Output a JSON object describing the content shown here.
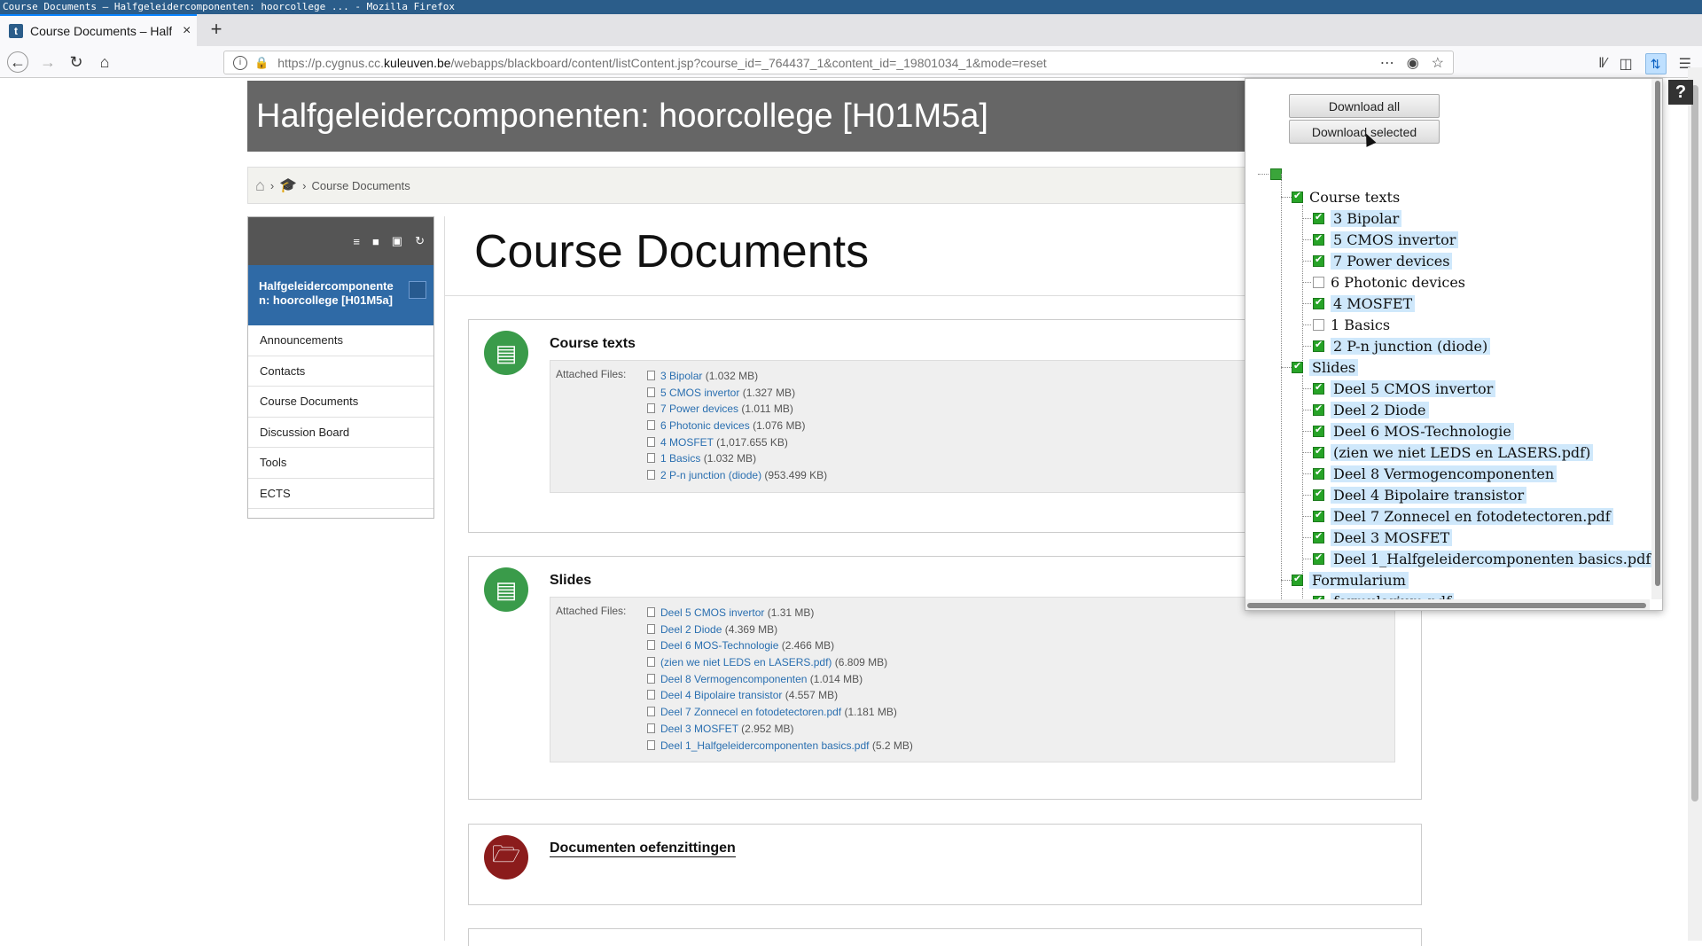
{
  "window": {
    "title": "Course Documents – Halfgeleidercomponenten: hoorcollege ... - Mozilla Firefox"
  },
  "tab": {
    "favicon": "t",
    "title": "Course Documents – Halfgeleidercomponenten",
    "close": "×",
    "new": "+"
  },
  "nav": {
    "url_prefix": "https://p.cygnus.cc.",
    "url_domain": "kuleuven.be",
    "url_path": "/webapps/blackboard/content/listContent.jsp?course_id=_764437_1&content_id=_19801034_1&mode=reset"
  },
  "course": {
    "header": "Halfgeleidercomponenten: hoorcollege [H01M5a]"
  },
  "breadcrumbs": {
    "current": "Course Documents"
  },
  "leftnav": {
    "course_name": "Halfgeleidercomponente n: hoorcollege [H01M5a]",
    "items": [
      "Announcements",
      "Contacts",
      "Course Documents",
      "Discussion Board",
      "Tools",
      "ECTS"
    ]
  },
  "page": {
    "title": "Course Documents"
  },
  "blocks": {
    "course_texts": {
      "title": "Course texts",
      "attached_label": "Attached Files:",
      "files": [
        {
          "name": "3 Bipolar",
          "size": "(1.032 MB)"
        },
        {
          "name": "5 CMOS invertor",
          "size": "(1.327 MB)"
        },
        {
          "name": "7 Power devices",
          "size": "(1.011 MB)"
        },
        {
          "name": "6 Photonic devices",
          "size": "(1.076 MB)"
        },
        {
          "name": "4 MOSFET",
          "size": "(1,017.655 KB)"
        },
        {
          "name": "1 Basics",
          "size": "(1.032 MB)"
        },
        {
          "name": "2 P-n junction (diode)",
          "size": "(953.499 KB)"
        }
      ]
    },
    "slides": {
      "title": "Slides",
      "attached_label": "Attached Files:",
      "files": [
        {
          "name": "Deel 5 CMOS invertor",
          "size": "(1.31 MB)"
        },
        {
          "name": "Deel 2 Diode",
          "size": "(4.369 MB)"
        },
        {
          "name": "Deel 6 MOS-Technologie",
          "size": "(2.466 MB)"
        },
        {
          "name": "(zien we niet LEDS en LASERS.pdf)",
          "size": "(6.809 MB)"
        },
        {
          "name": "Deel 8 Vermogencomponenten",
          "size": "(1.014 MB)"
        },
        {
          "name": "Deel 4 Bipolaire transistor",
          "size": "(4.557 MB)"
        },
        {
          "name": "Deel 7 Zonnecel en fotodetectoren.pdf",
          "size": "(1.181 MB)"
        },
        {
          "name": "Deel 3 MOSFET",
          "size": "(2.952 MB)"
        },
        {
          "name": "Deel 1_Halfgeleidercomponenten basics.pdf",
          "size": "(5.2 MB)"
        }
      ]
    },
    "oefen": {
      "title": "Documenten oefenzittingen"
    }
  },
  "popup": {
    "download_all": "Download all",
    "download_selected": "Download selected",
    "groups": [
      {
        "name": "Course texts",
        "items": [
          {
            "label": "3 Bipolar",
            "checked": true
          },
          {
            "label": "5 CMOS invertor",
            "checked": true
          },
          {
            "label": "7 Power devices",
            "checked": true
          },
          {
            "label": "6 Photonic devices",
            "checked": false
          },
          {
            "label": "4 MOSFET",
            "checked": true
          },
          {
            "label": "1 Basics",
            "checked": false
          },
          {
            "label": "2 P-n junction (diode)",
            "checked": true
          }
        ]
      },
      {
        "name": "Slides",
        "items": [
          {
            "label": "Deel 5 CMOS invertor",
            "checked": true
          },
          {
            "label": "Deel 2 Diode",
            "checked": true
          },
          {
            "label": "Deel 6 MOS-Technologie",
            "checked": true
          },
          {
            "label": "(zien we niet LEDS en LASERS.pdf)",
            "checked": true
          },
          {
            "label": "Deel 8 Vermogencomponenten",
            "checked": true
          },
          {
            "label": "Deel 4 Bipolaire transistor",
            "checked": true
          },
          {
            "label": "Deel 7 Zonnecel en fotodetectoren.pdf",
            "checked": true
          },
          {
            "label": "Deel 3 MOSFET",
            "checked": true
          },
          {
            "label": "Deel 1_Halfgeleidercomponenten basics.pdf",
            "checked": true
          }
        ]
      },
      {
        "name": "Formularium",
        "items": [
          {
            "label": "formularium.pdf",
            "checked": true
          }
        ]
      }
    ]
  },
  "colors": {
    "accent": "#2f6aa6",
    "header_bg": "#666666",
    "checked": "#27a327",
    "selected_bg": "#cfe8fb",
    "link": "#2a6fb0"
  }
}
